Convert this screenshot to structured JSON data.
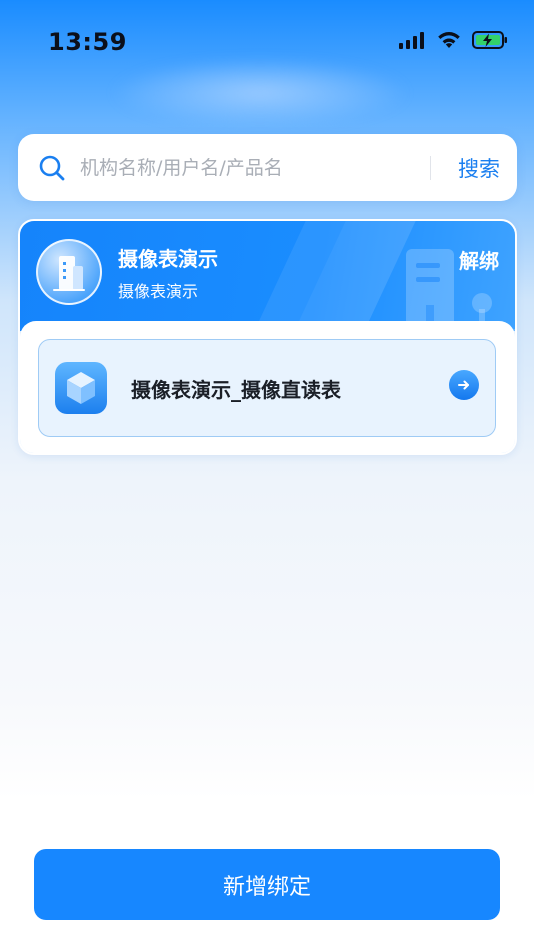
{
  "status_bar": {
    "time": "13:59"
  },
  "search": {
    "placeholder": "机构名称/用户名/产品名",
    "button_label": "搜索"
  },
  "org_card": {
    "title": "摄像表演示",
    "subtitle": "摄像表演示",
    "unbind_label": "解绑",
    "devices": [
      {
        "label": "摄像表演示_摄像直读表"
      }
    ]
  },
  "footer": {
    "add_binding_label": "新增绑定"
  },
  "colors": {
    "primary": "#1787ff",
    "accent_text": "#1a7ff0"
  },
  "icons": {
    "search": "search-icon",
    "org_avatar": "building-icon",
    "device": "cube-icon",
    "arrow": "arrow-right-icon"
  }
}
